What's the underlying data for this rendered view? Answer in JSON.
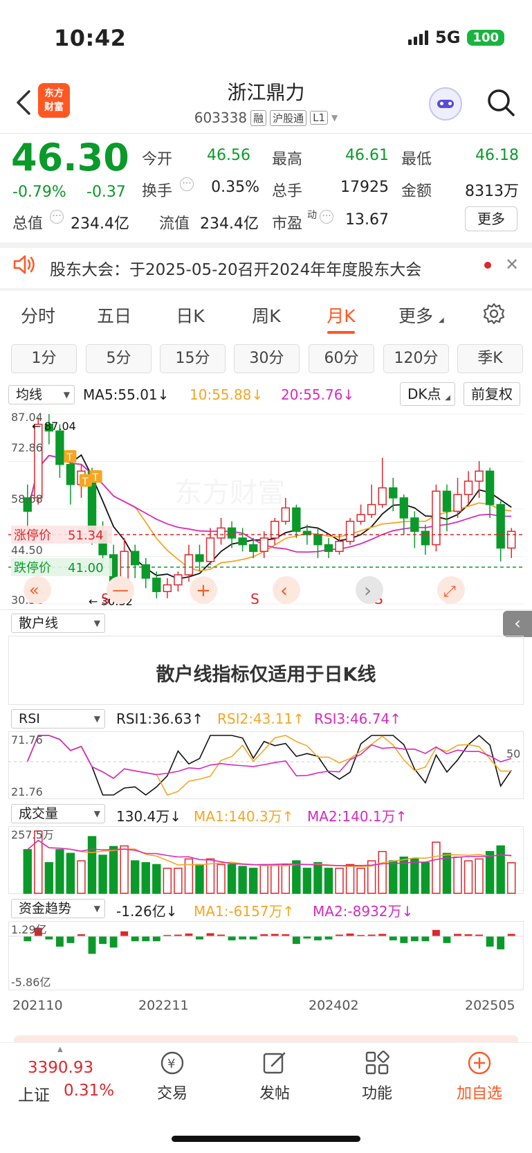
{
  "status": {
    "time": "10:42",
    "network": "5G",
    "battery": "100"
  },
  "nav": {
    "logo": "东方\n财富",
    "title": "浙江鼎力",
    "code": "603338",
    "tags": [
      "融",
      "沪股通",
      "L1"
    ]
  },
  "quote": {
    "price": "46.30",
    "change_pct": "-0.79%",
    "change_abs": "-0.37",
    "rows": [
      [
        {
          "label": "今开",
          "value": "46.56",
          "color": "green"
        },
        {
          "label": "最高",
          "value": "46.61",
          "color": "green"
        },
        {
          "label": "最低",
          "value": "46.18",
          "color": "green"
        }
      ],
      [
        {
          "label": "换手",
          "value": "0.35%",
          "color": "dark"
        },
        {
          "label": "总手",
          "value": "17925",
          "color": "dark"
        },
        {
          "label": "金额",
          "value": "8313万",
          "color": "dark"
        }
      ],
      [
        {
          "label": "总值",
          "value": "234.4亿",
          "color": "dark"
        },
        {
          "label": "流值",
          "value": "234.4亿",
          "color": "dark"
        },
        {
          "label": "市盈",
          "value": "13.67",
          "color": "dark"
        }
      ]
    ],
    "pe_superscript": "动",
    "more_label": "更多"
  },
  "notice": {
    "text": "股东大会：于2025-05-20召开2024年年度股东大会"
  },
  "period_tabs": [
    "分时",
    "五日",
    "日K",
    "周K",
    "月K",
    "更多"
  ],
  "active_period": "月K",
  "sub_tabs": [
    "1分",
    "5分",
    "15分",
    "30分",
    "60分",
    "120分",
    "季K"
  ],
  "kline": {
    "selector": "均线",
    "ma5": "MA5:55.01↓",
    "ma10": "10:55.88↓",
    "ma20": "20:55.76↓",
    "dk_label": "DK点",
    "fq_label": "前复权",
    "y_labels": [
      "87.04",
      "72.86",
      "58.68",
      "44.50",
      "30.32"
    ],
    "max_label": "87.04",
    "min_label": "30.32",
    "limit_up_label": "涨停价",
    "limit_up_value": "51.34",
    "limit_down_label": "跌停价",
    "limit_down_value": "41.00",
    "watermark": "东方财富",
    "t_marker": "T",
    "s_marker": "S",
    "s_marker_positions": [
      0.18,
      0.47,
      0.71
    ],
    "t_marker_positions": [
      [
        0.12,
        0.9
      ],
      [
        0.15,
        0.78
      ],
      [
        0.17,
        0.8
      ]
    ],
    "controls": [
      "«",
      "—",
      "+",
      "‹",
      "›",
      "⤢"
    ]
  },
  "scatter": {
    "selector": "散户线",
    "message": "散户线指标仅适用于日K线"
  },
  "rsi": {
    "selector": "RSI",
    "rsi1": "RSI1:36.63↑",
    "rsi2": "RSI2:43.11↑",
    "rsi3": "RSI3:46.74↑",
    "top": "71.76",
    "bottom": "21.76",
    "mid": "50"
  },
  "volume": {
    "selector": "成交量",
    "value": "130.4万↓",
    "ma1": "MA1:140.3万↑",
    "ma2": "MA2:140.1万↑",
    "top": "257.5万"
  },
  "fund": {
    "selector": "资金趋势",
    "value": "-1.26亿↓",
    "ma1": "MA1:-6157万↑",
    "ma2": "MA2:-8932万↓",
    "top": "1.29亿",
    "bottom": "-5.86亿"
  },
  "x_axis": [
    "202110",
    "202211",
    "202402",
    "202505"
  ],
  "bottom": {
    "index_value": "3390.93",
    "index_name": "上证",
    "index_change": "0.31%",
    "buttons": [
      "交易",
      "发帖",
      "功能",
      "加自选"
    ]
  },
  "colors": {
    "up": "#e0262b",
    "down": "#0a9a2a",
    "accent": "#ff5722",
    "ma5": "#111111",
    "ma10": "#f5a623",
    "ma20": "#d62bbd"
  },
  "chart_data": {
    "type": "candlestick",
    "y_range": [
      30.32,
      87.04
    ],
    "candles": [
      [
        62,
        58,
        66,
        50
      ],
      [
        62,
        84,
        86,
        60
      ],
      [
        84,
        82,
        87.04,
        78
      ],
      [
        82,
        72,
        84,
        68
      ],
      [
        72,
        66,
        74,
        60
      ],
      [
        66,
        70,
        72,
        62
      ],
      [
        70,
        52,
        71,
        48
      ],
      [
        52,
        45,
        55,
        42
      ],
      [
        45,
        34,
        48,
        30.32
      ],
      [
        34,
        46,
        50,
        32
      ],
      [
        46,
        42,
        48,
        38
      ],
      [
        42,
        38,
        44,
        35
      ],
      [
        38,
        34,
        40,
        32
      ],
      [
        34,
        36,
        38,
        32
      ],
      [
        36,
        39,
        40,
        34
      ],
      [
        39,
        45,
        48,
        37
      ],
      [
        45,
        43,
        48,
        40
      ],
      [
        43,
        50,
        53,
        42
      ],
      [
        50,
        53,
        56,
        48
      ],
      [
        53,
        50,
        55,
        47
      ],
      [
        50,
        48,
        53,
        46
      ],
      [
        48,
        46,
        50,
        44
      ],
      [
        46,
        50,
        52,
        44
      ],
      [
        50,
        55,
        56,
        48
      ],
      [
        55,
        59,
        62,
        54
      ],
      [
        59,
        52,
        60,
        50
      ],
      [
        52,
        51,
        54,
        48
      ],
      [
        51,
        48,
        53,
        44
      ],
      [
        48,
        46,
        50,
        44
      ],
      [
        46,
        49,
        51,
        45
      ],
      [
        49,
        55,
        56,
        48
      ],
      [
        55,
        57,
        60,
        54
      ],
      [
        57,
        60,
        66,
        56
      ],
      [
        60,
        65,
        74,
        59
      ],
      [
        65,
        62,
        68,
        58
      ],
      [
        62,
        56,
        63,
        51
      ],
      [
        56,
        52,
        58,
        47
      ],
      [
        52,
        48,
        54,
        45
      ],
      [
        48,
        64,
        66,
        46
      ],
      [
        64,
        58,
        66,
        52
      ],
      [
        58,
        63,
        68,
        56
      ],
      [
        63,
        67,
        70,
        60
      ],
      [
        67,
        70,
        73,
        62
      ],
      [
        70,
        60,
        71,
        56
      ],
      [
        60,
        47,
        61,
        43
      ],
      [
        47,
        52,
        53,
        44
      ]
    ]
  }
}
